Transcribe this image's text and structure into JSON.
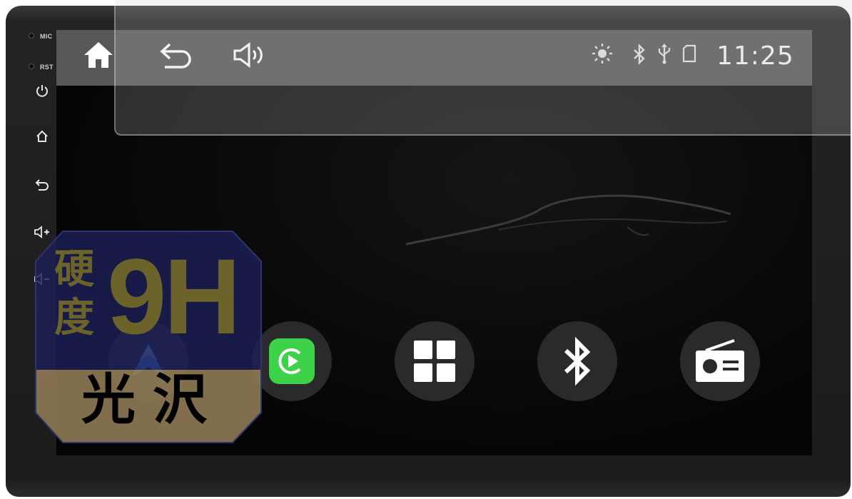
{
  "device": {
    "side_labels": {
      "mic": "MIC",
      "rst": "RST"
    },
    "side_buttons": [
      "power-icon",
      "home-icon",
      "back-icon",
      "volume-up-icon",
      "volume-down-icon"
    ]
  },
  "statusbar": {
    "nav_icons": [
      "home-icon",
      "back-icon",
      "volume-icon"
    ],
    "status_icons": [
      "brightness-icon",
      "bluetooth-icon",
      "usb-icon",
      "sd-card-icon"
    ],
    "time": "11:25"
  },
  "apps": [
    "android-auto-icon",
    "carplay-icon",
    "apps-grid-icon",
    "bluetooth-icon",
    "radio-icon"
  ],
  "badge": {
    "hardness_1": "硬",
    "hardness_2": "度",
    "rating": "9H",
    "gloss_1": "光",
    "gloss_2": "沢"
  },
  "colors": {
    "carplay_green": "#3dd24a",
    "badge_top": "#1c1f57",
    "badge_bottom": "#8f7a55",
    "badge_text_gold": "#6b6329",
    "statusbar": "#585858"
  }
}
